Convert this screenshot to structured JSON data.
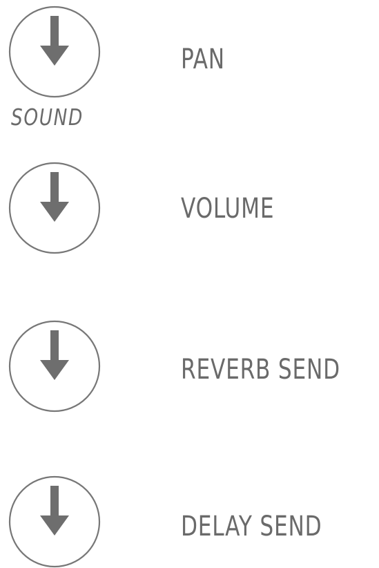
{
  "knobs": [
    {
      "label": "PAN",
      "sublabel": "SOUND",
      "icon": "down-arrow-knob-icon"
    },
    {
      "label": "VOLUME",
      "icon": "down-arrow-knob-icon"
    },
    {
      "label": "REVERB SEND",
      "icon": "down-arrow-knob-icon"
    },
    {
      "label": "DELAY SEND",
      "icon": "down-arrow-knob-icon"
    }
  ],
  "colors": {
    "text": "#6a6a6a",
    "circle": "#777777",
    "arrow": "#6e6e6e",
    "background": "#ffffff"
  }
}
